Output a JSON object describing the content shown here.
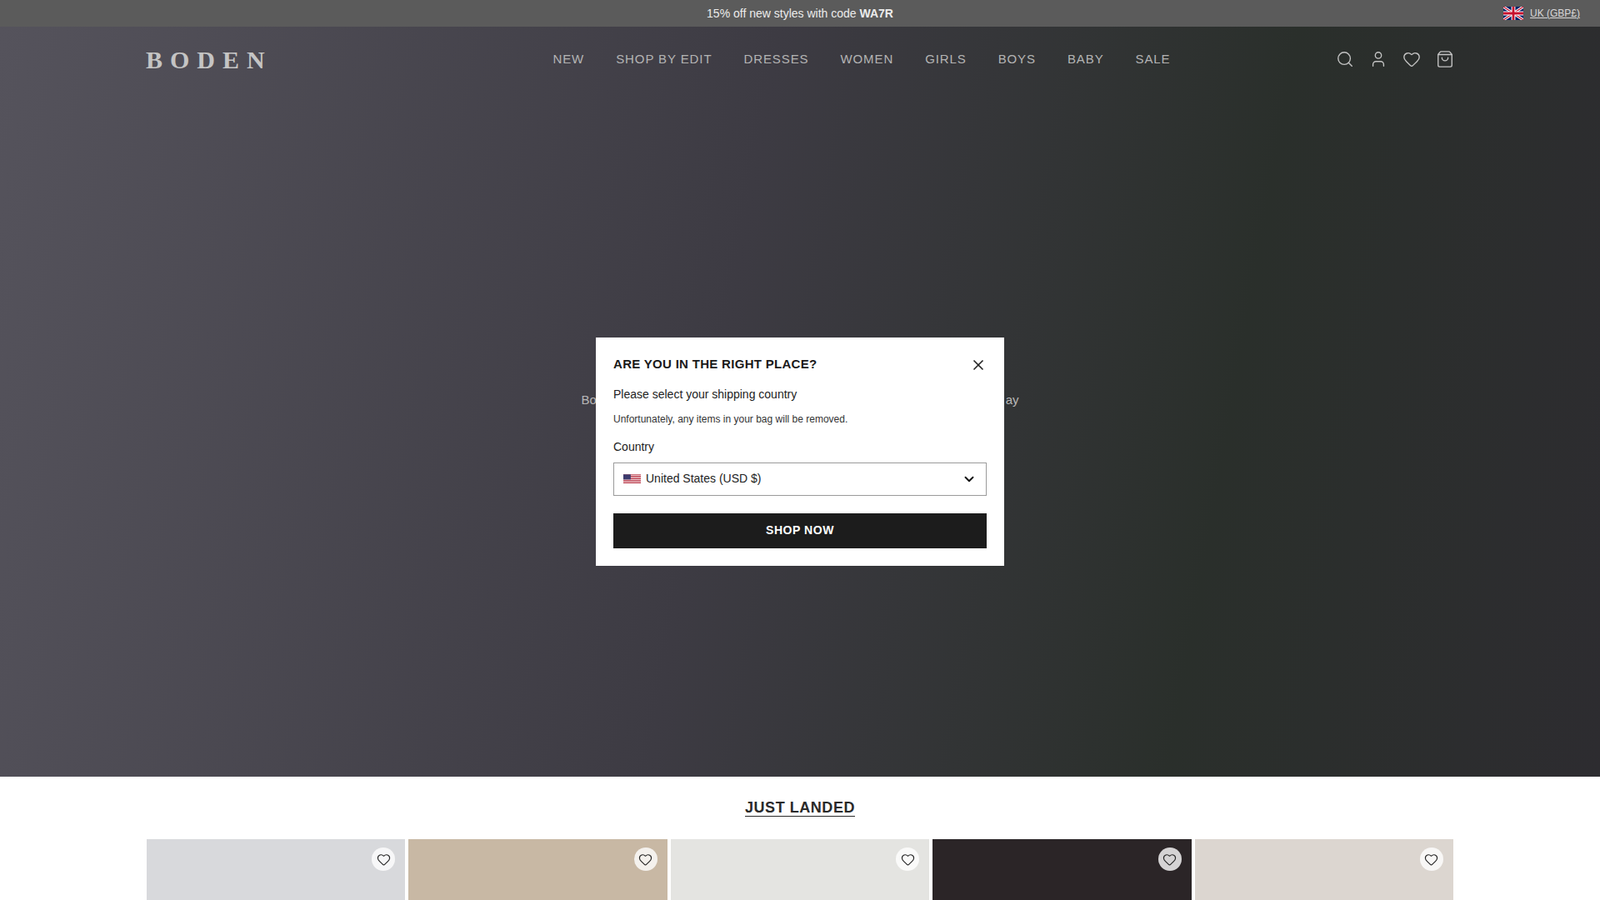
{
  "promo_bar": {
    "text": "15% off new styles with code",
    "code": "WA7R",
    "region": "UK (GBP£)"
  },
  "header": {
    "logo": "BODEN",
    "nav": [
      "NEW",
      "SHOP BY EDIT",
      "DRESSES",
      "WOMEN",
      "GIRLS",
      "BOYS",
      "BABY",
      "SALE"
    ]
  },
  "hero": {
    "text_left": "Bo",
    "text_right": "ay"
  },
  "just_landed": {
    "title": "JUST LANDED",
    "products": [
      {
        "wishlisted": false,
        "color": "#d8d9dc"
      },
      {
        "wishlisted": false,
        "color": "#c8b8a4"
      },
      {
        "wishlisted": false,
        "color": "#e4e4e1"
      },
      {
        "wishlisted": false,
        "color": "#2b2527"
      },
      {
        "wishlisted": false,
        "color": "#dcd6d0"
      }
    ]
  },
  "dialog": {
    "title": "ARE YOU IN THE RIGHT PLACE?",
    "prompt": "Please select your shipping country",
    "warning": "Unfortunately, any items in your bag will be removed.",
    "field_label": "Country",
    "selected_country": "United States (USD $)",
    "button": "SHOP NOW"
  }
}
